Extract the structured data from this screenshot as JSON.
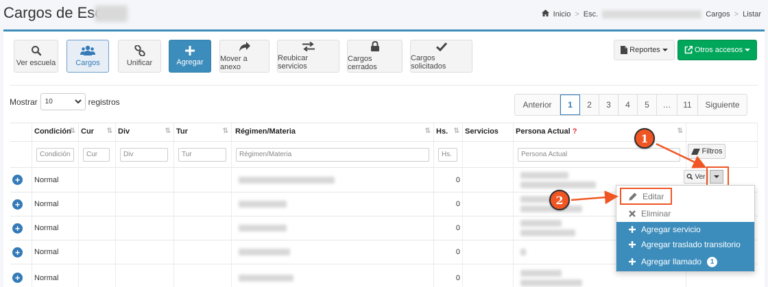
{
  "header": {
    "title": "Cargos de Esc.",
    "breadcrumb": {
      "home": "Inicio",
      "school": "Esc.",
      "section": "Cargos",
      "current": "Listar"
    }
  },
  "toolbar": {
    "buttons": [
      {
        "label": "Ver escuela",
        "icon": "search-icon"
      },
      {
        "label": "Cargos",
        "icon": "users-icon"
      },
      {
        "label": "Unificar",
        "icon": "link-icon"
      },
      {
        "label": "Agregar",
        "icon": "plus-icon"
      },
      {
        "label": "Mover a anexo",
        "icon": "share-arrow-icon"
      },
      {
        "label": "Reubicar servicios",
        "icon": "exchange-icon"
      },
      {
        "label": "Cargos cerrados",
        "icon": "lock-icon"
      },
      {
        "label": "Cargos solicitados",
        "icon": "check-icon"
      }
    ],
    "reportes_label": "Reportes",
    "otros_label": "Otros accesos"
  },
  "length": {
    "prefix": "Mostrar",
    "value": "10",
    "suffix": "registros"
  },
  "pagination": {
    "prev": "Anterior",
    "pages": [
      "1",
      "2",
      "3",
      "4",
      "5",
      "…",
      "11"
    ],
    "next": "Siguiente",
    "current": "1"
  },
  "table": {
    "columns": {
      "condicion": "Condición",
      "cur": "Cur",
      "div": "Div",
      "tur": "Tur",
      "regimen": "Régimen/Materia",
      "hs": "Hs.",
      "servicios": "Servicios",
      "persona": "Persona Actual",
      "persona_mark": "?"
    },
    "filters": {
      "condicion": "Condición",
      "cur": "Cur",
      "div": "Div",
      "tur": "Tur",
      "regimen": "Régimen/Materia",
      "hs": "Hs.",
      "persona": "Persona Actual",
      "filtros_label": "Filtros"
    },
    "rows": [
      {
        "condicion": "Normal",
        "hs": "0"
      },
      {
        "condicion": "Normal",
        "hs": "0"
      },
      {
        "condicion": "Normal",
        "hs": "0"
      },
      {
        "condicion": "Normal",
        "hs": "0"
      },
      {
        "condicion": "Normal",
        "hs": "0"
      }
    ],
    "ver_label": "Ver"
  },
  "menu": {
    "editar": "Editar",
    "eliminar": "Eliminar",
    "agregar_servicio": "Agregar servicio",
    "agregar_traslado": "Agregar traslado transitorio",
    "agregar_llamado": "Agregar llamado",
    "llamado_badge": "1"
  },
  "annotations": {
    "step1": "1",
    "step2": "2"
  },
  "colors": {
    "primary": "#3c8dbc",
    "success": "#00a65a",
    "annotation": "#ef5623"
  }
}
